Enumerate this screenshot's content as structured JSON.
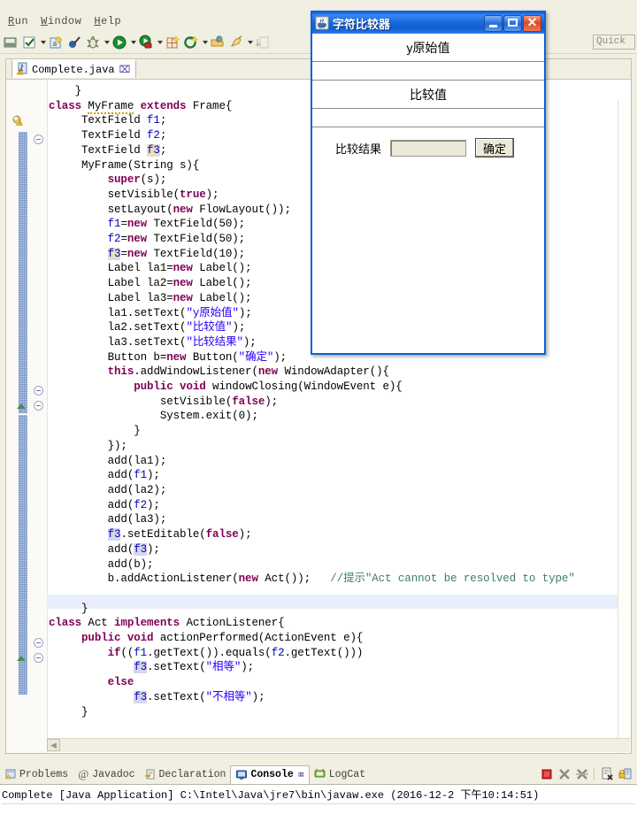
{
  "app": {
    "menu": [
      {
        "label": "Run",
        "mnemonic": "R",
        "rest": "un"
      },
      {
        "label": "Window",
        "mnemonic": "W",
        "rest": "indow"
      },
      {
        "label": "Help",
        "mnemonic": "H",
        "rest": "elp"
      }
    ],
    "quick_access": {
      "placeholder": "Quick",
      "value": "Quick"
    },
    "toolbar_icons": [
      "save-all-icon",
      "check-mark-icon",
      "check-mark-dropdown-arrow",
      "new-annotation-icon",
      "skip-breakpoints-icon",
      "debug-icon",
      "debug-dropdown-arrow",
      "run-icon",
      "run-dropdown-arrow",
      "run-external-tools-icon",
      "external-tools-dropdown-arrow",
      "new-java-project-icon",
      "new-class-icon",
      "new-class-dropdown-arrow",
      "open-type-icon",
      "search-icon",
      "search-dropdown-arrow",
      "next-annotation-icon"
    ]
  },
  "editor": {
    "tab": {
      "filename": "Complete.java",
      "close_glyph": "⌧",
      "file_icon": "java-file-warning-icon"
    },
    "highlighted_line_index": 38,
    "code_lines": [
      "    }",
      "class MyFrame extends Frame{",
      "     TextField f1;",
      "     TextField f2;",
      "     TextField f3;",
      "     MyFrame(String s){",
      "         super(s);",
      "         setVisible(true);",
      "         setLayout(new FlowLayout());",
      "         f1=new TextField(50);",
      "         f2=new TextField(50);",
      "         f3=new TextField(10);",
      "         Label la1=new Label();",
      "         Label la2=new Label();",
      "         Label la3=new Label();",
      "         la1.setText(\"y原始值\");",
      "         la2.setText(\"比较值\");",
      "         la3.setText(\"比较结果\");",
      "         Button b=new Button(\"确定\");",
      "         this.addWindowListener(new WindowAdapter(){",
      "             public void windowClosing(WindowEvent e){",
      "                 setVisible(false);",
      "                 System.exit(0);",
      "             }",
      "         });",
      "         add(la1);",
      "         add(f1);",
      "         add(la2);",
      "         add(f2);",
      "         add(la3);",
      "         f3.setEditable(false);",
      "         add(f3);",
      "         add(b);",
      "         b.addActionListener(new Act());   //提示\"Act cannot be resolved to type\"",
      "",
      "     }",
      "class Act implements ActionListener{",
      "     public void actionPerformed(ActionEvent e){",
      "         if((f1.getText()).equals(f2.getText()))",
      "             f3.setText(\"相等\");",
      "         else",
      "             f3.setText(\"不相等\");",
      "     }"
    ],
    "comment_text": "//提示\"Act cannot be resolved to type\"",
    "colors": {
      "keyword": "#7f0055",
      "string": "#2a00ff",
      "comment": "#3f7f5f",
      "field": "#0000c0",
      "current_line": "#e8eefb",
      "occurrence_highlight": "#d6d6f0"
    }
  },
  "console": {
    "tabs": [
      {
        "label": "Problems",
        "icon": "problems-icon",
        "active": false
      },
      {
        "label": "Javadoc",
        "icon": "javadoc-at-icon",
        "active": false
      },
      {
        "label": "Declaration",
        "icon": "declaration-icon",
        "active": false
      },
      {
        "label": "Console",
        "icon": "console-icon",
        "active": true,
        "close_glyph": "⌧"
      },
      {
        "label": "LogCat",
        "icon": "logcat-icon",
        "active": false
      }
    ],
    "tools": [
      "terminate-icon",
      "remove-launch-icon",
      "remove-all-terminated-icon",
      "clear-console-icon",
      "scroll-lock-icon"
    ],
    "launch_line": "Complete [Java Application] C:\\Intel\\Java\\jre7\\bin\\javaw.exe  (2016-12-2 下午10:14:51)"
  },
  "dialog": {
    "title": "字符比较器",
    "icon": "java-coffee-cup-icon",
    "buttons": {
      "minimize": "minimize-button",
      "maximize": "maximize-button",
      "close_glyph": "✕"
    },
    "label_original": "y原始值",
    "label_compare": "比较值",
    "label_result": "比较结果",
    "field_original_value": "",
    "field_compare_value": "",
    "field_result_value": "",
    "ok_button": "确定"
  }
}
